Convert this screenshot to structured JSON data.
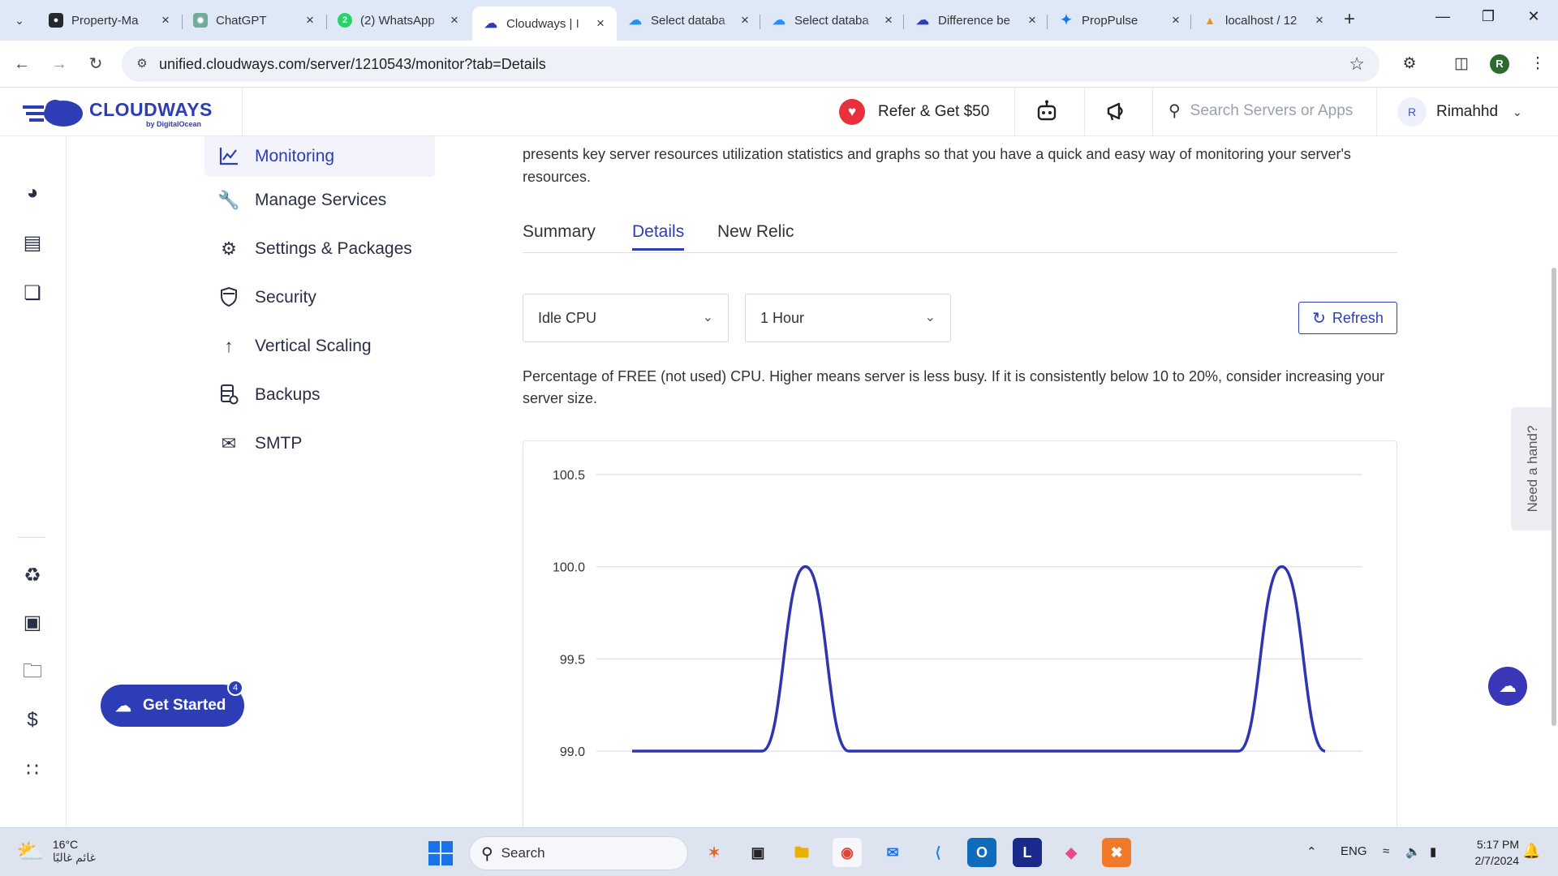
{
  "browser": {
    "tabs": [
      {
        "title": "Property-Ma",
        "favicon": "github-icon",
        "color": "#24292f"
      },
      {
        "title": "ChatGPT",
        "favicon": "chatgpt-icon",
        "color": "#74aa9c"
      },
      {
        "title": "(2) WhatsApp",
        "favicon": "whatsapp-icon",
        "color": "#25d366"
      },
      {
        "title": "Cloudways | I",
        "favicon": "cloudways-icon",
        "color": "#2d3db5"
      },
      {
        "title": "Select databa",
        "favicon": "azure-icon",
        "color": "#1e90ff"
      },
      {
        "title": "Select databa",
        "favicon": "azure-icon",
        "color": "#1e90ff"
      },
      {
        "title": "Difference be",
        "favicon": "cloudways-icon",
        "color": "#2d3db5"
      },
      {
        "title": "PropPulse",
        "favicon": "proppulse-icon",
        "color": "#1877f2"
      },
      {
        "title": "localhost / 12",
        "favicon": "phpmyadmin-icon",
        "color": "#f29111"
      }
    ],
    "url": "unified.cloudways.com/server/1210543/monitor?tab=Details",
    "profile_initial": "R"
  },
  "header": {
    "brand": "CLOUDWAYS",
    "brand_sub": "by DigitalOcean",
    "refer_label": "Refer & Get $50",
    "search_placeholder": "Search Servers or Apps",
    "user_initial": "R",
    "user_name": "Rimahhd"
  },
  "submenu": [
    {
      "label": "Monitoring",
      "icon": "chart-line-icon",
      "active": true
    },
    {
      "label": "Manage Services",
      "icon": "wrench-icon"
    },
    {
      "label": "Settings & Packages",
      "icon": "gear-icon"
    },
    {
      "label": "Security",
      "icon": "shield-icon"
    },
    {
      "label": "Vertical Scaling",
      "icon": "arrow-up-icon"
    },
    {
      "label": "Backups",
      "icon": "backup-icon"
    },
    {
      "label": "SMTP",
      "icon": "mail-icon"
    }
  ],
  "main": {
    "intro": "presents key server resources utilization statistics and graphs so that you have a quick and easy way of monitoring your server's resources.",
    "tabs": [
      "Summary",
      "Details",
      "New Relic"
    ],
    "active_tab": "Details",
    "metric_select": "Idle CPU",
    "range_select": "1 Hour",
    "refresh_label": "Refresh",
    "description": "Percentage of FREE (not used) CPU. Higher means server is less busy. If it is consistently below 10 to 20%, consider increasing your server size."
  },
  "chart_data": {
    "type": "line",
    "title": "",
    "xlabel": "",
    "ylabel": "",
    "yticks": [
      99.0,
      99.5,
      100.0,
      100.5
    ],
    "ylim": [
      99.0,
      100.5
    ],
    "grid": true,
    "color": "#2d36b0",
    "series": [
      {
        "values": [
          99,
          99,
          99,
          99,
          100,
          99,
          99,
          99,
          99,
          99,
          99,
          99,
          99,
          99,
          99,
          100,
          99
        ]
      }
    ]
  },
  "floating": {
    "get_started": "Get Started",
    "get_started_badge": "4",
    "need_hand": "Need a hand?"
  },
  "taskbar": {
    "weather_temp": "16°C",
    "weather_desc": "غائم غالبًا",
    "search": "Search",
    "lang": "ENG",
    "time": "5:17 PM",
    "date": "2/7/2024"
  },
  "colors": {
    "brand": "#2d3db5",
    "accent_red": "#e8303d"
  }
}
